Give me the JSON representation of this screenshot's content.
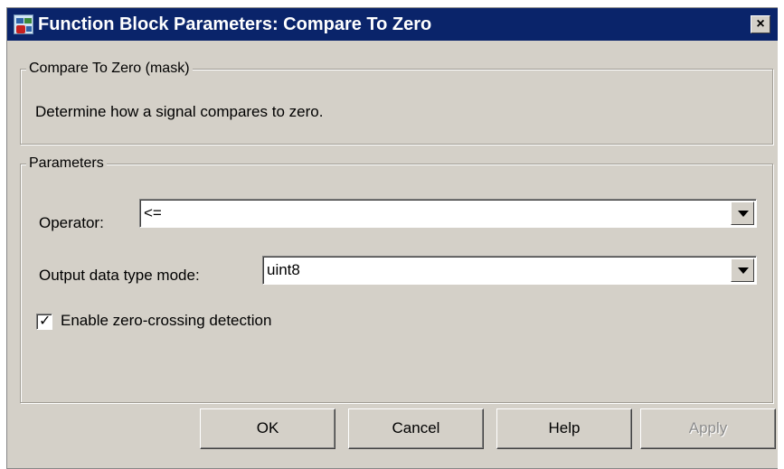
{
  "window": {
    "title": "Function Block Parameters: Compare To Zero",
    "close_label": "×"
  },
  "mask_group": {
    "legend": "Compare To Zero (mask)",
    "description": "Determine how a signal compares to zero."
  },
  "parameters": {
    "legend": "Parameters",
    "operator": {
      "label": "Operator:",
      "value": "<="
    },
    "output_type": {
      "label": "Output data type mode:",
      "value": "uint8"
    },
    "zero_crossing": {
      "label": "Enable zero-crossing detection",
      "checked": true,
      "mark": "✓"
    }
  },
  "buttons": {
    "ok": "OK",
    "cancel": "Cancel",
    "help": "Help",
    "apply": "Apply",
    "apply_enabled": false
  },
  "colors": {
    "titlebar": "#0a246a",
    "dialog_bg": "#d4d0c8"
  }
}
